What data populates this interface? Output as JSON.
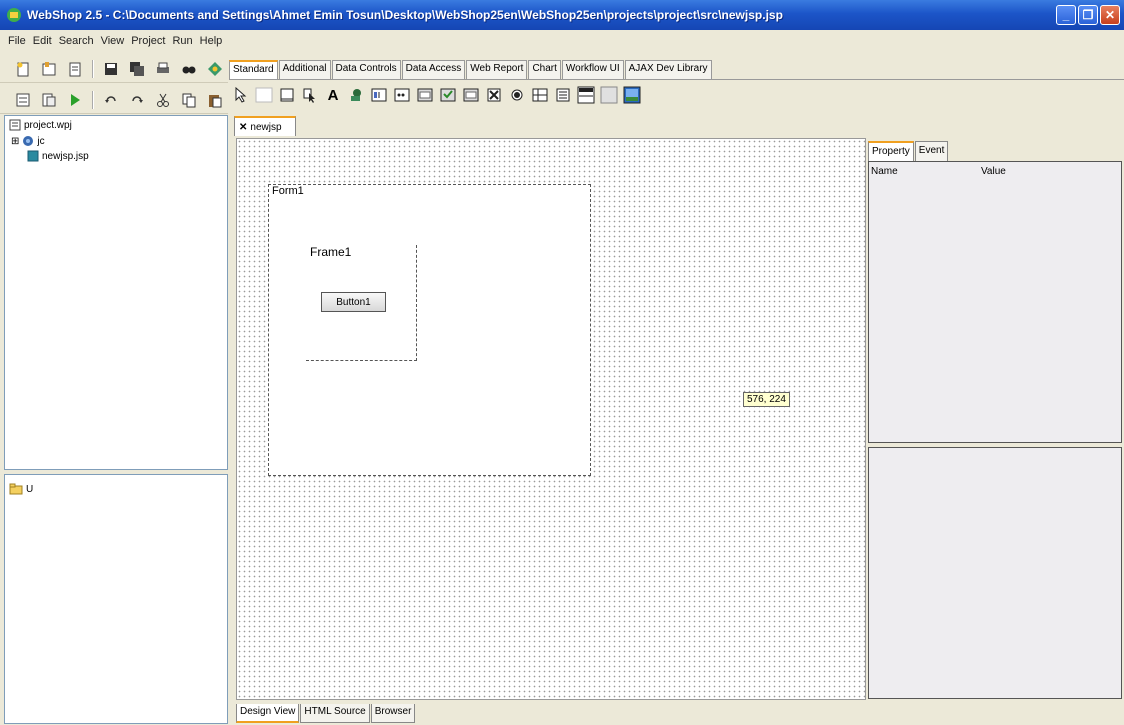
{
  "window": {
    "title": "WebShop 2.5 - C:\\Documents and Settings\\Ahmet Emin Tosun\\Desktop\\WebShop25en\\WebShop25en\\projects\\project\\src\\newjsp.jsp",
    "minimize": "_",
    "restore": "❐",
    "close": "✕"
  },
  "menu": [
    "File",
    "Edit",
    "Search",
    "View",
    "Project",
    "Run",
    "Help"
  ],
  "palette": {
    "tabs": [
      "Standard",
      "Additional",
      "Data Controls",
      "Data Access",
      "Web Report",
      "Chart",
      "Workflow UI",
      "AJAX Dev Library"
    ],
    "active_tab": "Standard",
    "label_tool": "A"
  },
  "project_tree": {
    "root": "project.wpj",
    "expand": "⊞",
    "package": "jc",
    "file": "newjsp.jsp"
  },
  "folder_tree": {
    "root": "U"
  },
  "editor": {
    "tab_label": "newjsp",
    "tab_close": "✕",
    "form_label": "Form1",
    "frame_label": "Frame1",
    "button_label": "Button1",
    "coord_readout": "576, 224"
  },
  "view_tabs": [
    "Design View",
    "HTML Source",
    "Browser"
  ],
  "property_panel": {
    "tabs": [
      "Property",
      "Event"
    ],
    "col_name": "Name",
    "col_value": "Value"
  },
  "colors": {
    "titlebar": "#1c55c8",
    "active_tab_accent": "#f0a020"
  }
}
